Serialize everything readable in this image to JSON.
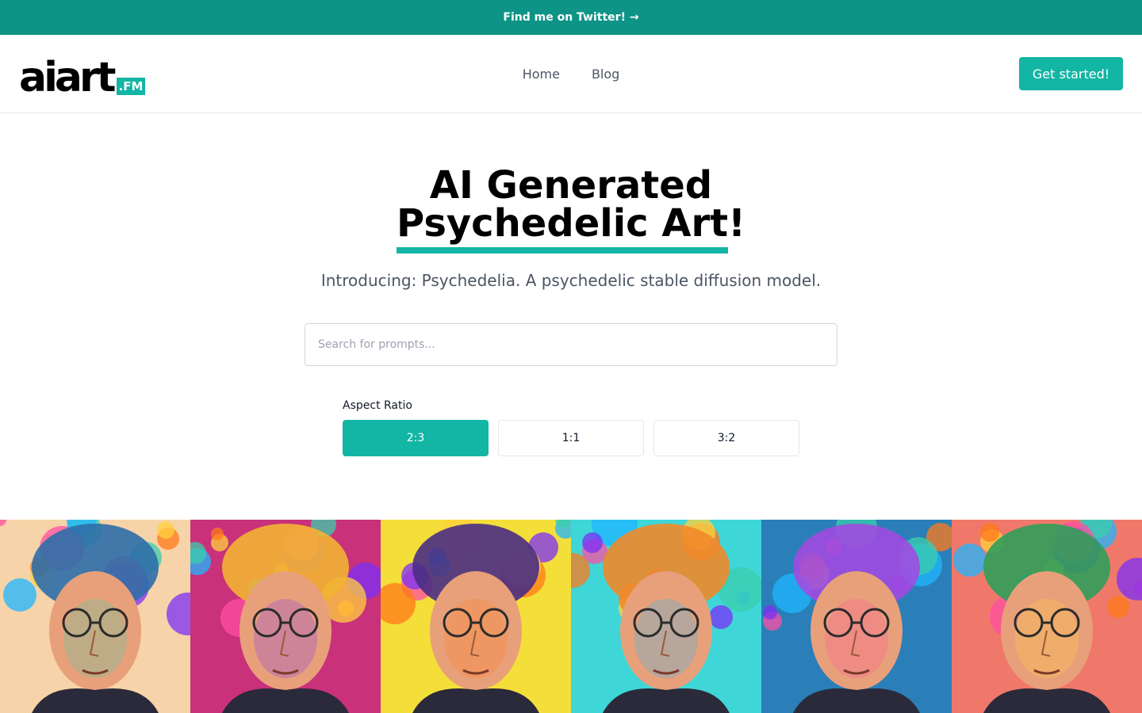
{
  "announcement": {
    "text": "Find me on Twitter! →"
  },
  "brand": {
    "logo_text": "aiart",
    "logo_badge": ".FM",
    "accent": "#13b5a4"
  },
  "nav": {
    "items": [
      {
        "label": "Home"
      },
      {
        "label": "Blog"
      }
    ]
  },
  "header": {
    "cta_label": "Get started!"
  },
  "hero": {
    "title_line1": "AI Generated",
    "title_line2": "Psychedelic Art!",
    "subtitle": "Introducing: Psychedelia. A psychedelic stable diffusion model."
  },
  "search": {
    "placeholder": "Search for prompts...",
    "value": ""
  },
  "aspect": {
    "label": "Aspect Ratio",
    "options": [
      {
        "label": "2:3",
        "selected": true
      },
      {
        "label": "1:1",
        "selected": false
      },
      {
        "label": "3:2",
        "selected": false
      }
    ]
  },
  "gallery": {
    "images": [
      {
        "bg": "#f6d3a8",
        "accent": "#2e6ea8"
      },
      {
        "bg": "#c9317a",
        "accent": "#f2b233"
      },
      {
        "bg": "#f4de3a",
        "accent": "#4a2e84"
      },
      {
        "bg": "#3fd6d8",
        "accent": "#f08a2a"
      },
      {
        "bg": "#2a7fb8",
        "accent": "#a04be0"
      },
      {
        "bg": "#f0786a",
        "accent": "#2f9e5a"
      }
    ]
  }
}
